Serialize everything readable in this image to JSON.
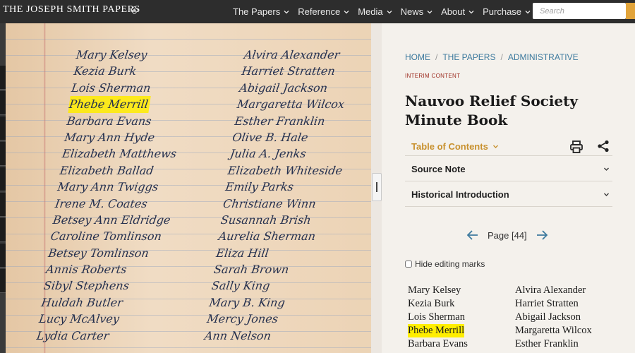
{
  "header": {
    "brand": "THE JOSEPH SMITH PAPERS",
    "nav": [
      {
        "label": "The Papers"
      },
      {
        "label": "Reference"
      },
      {
        "label": "Media"
      },
      {
        "label": "News"
      },
      {
        "label": "About"
      },
      {
        "label": "Purchase"
      }
    ],
    "search": {
      "placeholder": "Search",
      "value": ""
    }
  },
  "viewer": {
    "handwriting_left": [
      "Mary Kelsey",
      "Kezia Burk",
      "Lois Sherman",
      "Phebe Merrill",
      "Barbara Evans",
      "Mary Ann Hyde",
      "Elizabeth Matthews",
      "Elizabeth Ballad",
      "Mary Ann Twiggs",
      "Irene M. Coates",
      "Betsey Ann Eldridge",
      "Caroline Tomlinson",
      "Betsey Tomlinson",
      "Annis Roberts",
      "Sibyl Stephens",
      "Huldah Butler",
      "Lucy McAlvey",
      "Lydia Carter"
    ],
    "handwriting_right": [
      "Alvira Alexander",
      "Harriet Stratten",
      "Abigail Jackson",
      "Margaretta Wilcox",
      "Esther Franklin",
      "Olive B. Hale",
      "Julia A. Jenks",
      "Elizabeth Whiteside",
      "Emily Parks",
      "Christiane Winn",
      "Susannah Brish",
      "Aurelia Sherman",
      "Eliza Hill",
      "Sarah Brown",
      "Sally King",
      "Mary B. King",
      "Mercy Jones",
      "Ann Nelson"
    ],
    "highlighted_index": 3
  },
  "panel": {
    "breadcrumb": [
      "HOME",
      "THE PAPERS",
      "ADMINISTRATIVE"
    ],
    "interim_label": "INTERIM CONTENT",
    "title": "Nauvoo Relief Society Minute Book",
    "toc_label": "Table of Contents",
    "accordions": [
      "Source Note",
      "Historical Introduction"
    ],
    "page_label": "Page [44]",
    "hide_marks_label": "Hide editing marks",
    "hide_marks_checked": false,
    "transcript_left": [
      "Mary Kelsey",
      "Kezia Burk",
      "Lois Sherman",
      "Phebe Merrill",
      "Barbara Evans"
    ],
    "transcript_right": [
      "Alvira Alexander",
      "Harriet Stratten",
      "Abigail Jackson",
      "Margaretta Wilcox",
      "Esther Franklin"
    ],
    "highlight_index": 3
  },
  "colors": {
    "topbar": "#2d2d2d",
    "accent_gold": "#c8912e",
    "search_button": "#e2a43a",
    "link_blue": "#3d7a9e",
    "interim_red": "#9c2b1f",
    "highlight": "#ffee00",
    "panel_bg": "#f4f1ec"
  },
  "icons": {
    "brand_mark": "diamond-ornament-icon",
    "nav_chevron": "chevron-down-icon",
    "search_button": "search-icon",
    "print": "print-icon",
    "share": "share-icon",
    "prev_page": "arrow-left-icon",
    "next_page": "arrow-right-icon"
  }
}
